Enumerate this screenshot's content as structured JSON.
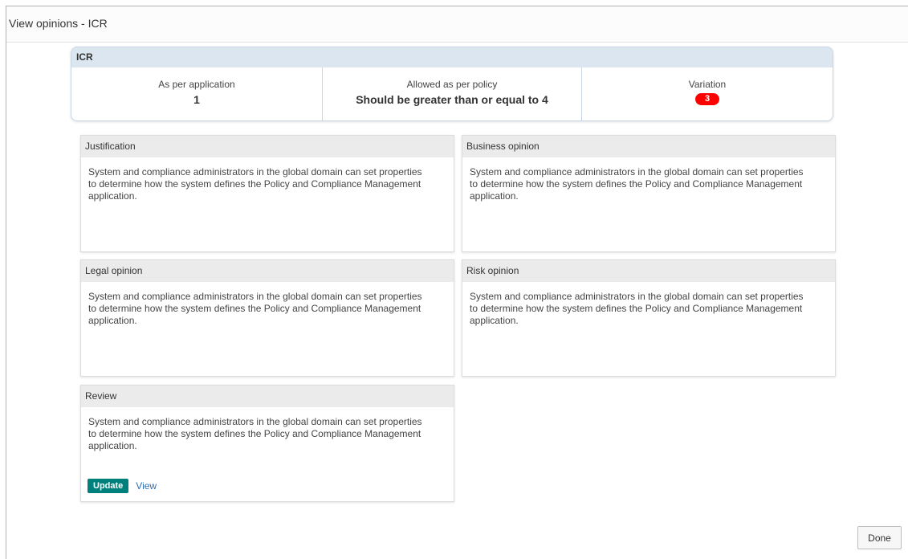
{
  "dialog": {
    "title": "View opinions - ICR"
  },
  "summary": {
    "title": "ICR",
    "as_per_application_label": "As per application",
    "as_per_application_value": "1",
    "allowed_label": "Allowed as per policy",
    "allowed_value": "Should be greater than or equal to 4",
    "variation_label": "Variation",
    "variation_value": "3",
    "variation_color": "#ff0000"
  },
  "cards": {
    "justification": {
      "title": "Justification",
      "text": "System and compliance administrators in the global domain can set properties to determine how the system defines the Policy and Compliance Management application."
    },
    "business": {
      "title": "Business opinion",
      "text": "System and compliance administrators in the global domain can set properties to determine how the system defines the Policy and Compliance Management application."
    },
    "legal": {
      "title": "Legal opinion",
      "text": "System and compliance administrators in the global domain can set properties to determine how the system defines the Policy and Compliance Management application."
    },
    "risk": {
      "title": "Risk opinion",
      "text": "System and compliance administrators in the global domain can set properties to determine how the system defines the Policy and Compliance Management application."
    },
    "review": {
      "title": "Review",
      "text": "System and compliance administrators in the global domain can set properties to determine how the system defines the Policy and Compliance Management application.",
      "update_label": "Update",
      "view_label": "View",
      "update_color": "#00807d"
    }
  },
  "footer": {
    "done_label": "Done"
  }
}
